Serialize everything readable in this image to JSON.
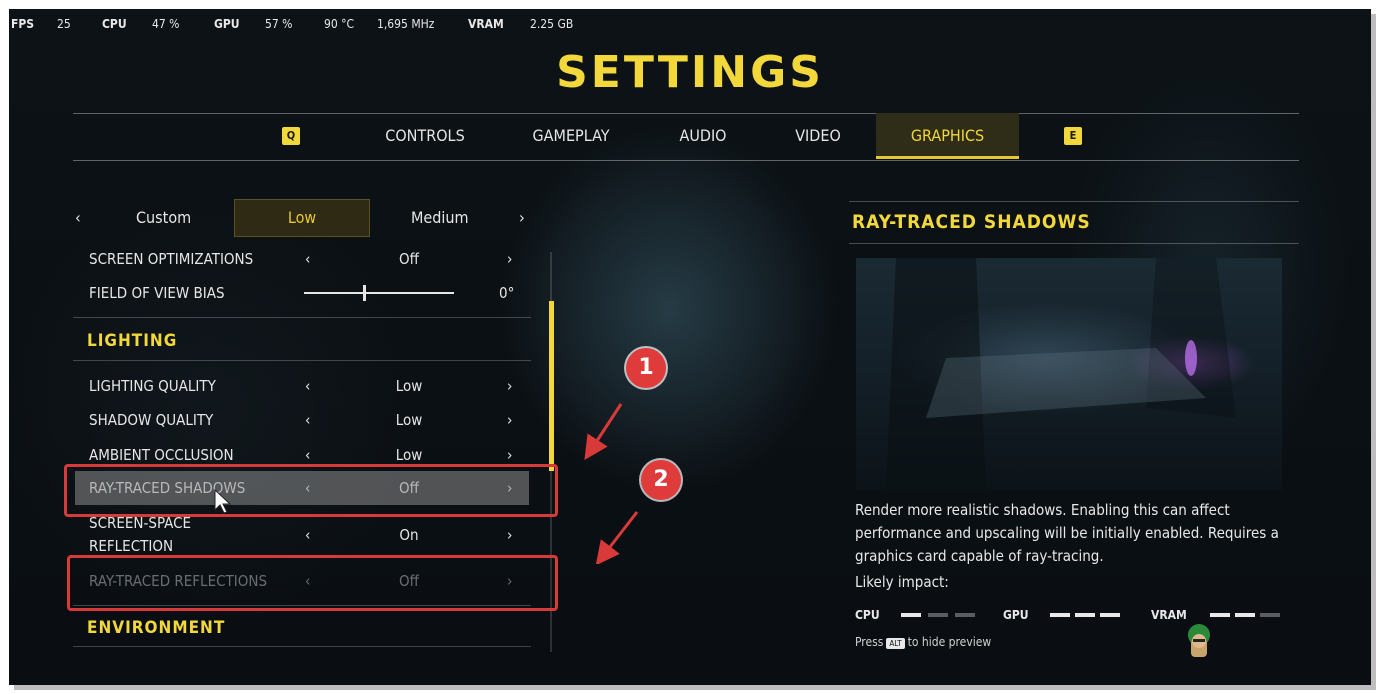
{
  "hud": {
    "fps_label": "FPS",
    "fps_value": "25",
    "cpu_label": "CPU",
    "cpu_value": "47 %",
    "gpu_label": "GPU",
    "gpu_value": "57 %",
    "temp": "90 °C",
    "clock": "1,695 MHz",
    "vram_label": "VRAM",
    "vram_value": "2.25 GB"
  },
  "title": "SETTINGS",
  "tabs": {
    "key_left": "Q",
    "key_right": "E",
    "items": [
      "CONTROLS",
      "GAMEPLAY",
      "AUDIO",
      "VIDEO",
      "GRAPHICS"
    ],
    "active": "GRAPHICS"
  },
  "presets": {
    "left_arrow": "‹",
    "right_arrow": "›",
    "items": [
      "Custom",
      "Low",
      "Medium"
    ],
    "active": "Low"
  },
  "settings": [
    {
      "label": "SCREEN OPTIMIZATIONS",
      "value": "Off"
    },
    {
      "label": "FIELD OF VIEW BIAS",
      "value": "0°",
      "slider": 0.4
    }
  ],
  "sections": {
    "lighting": "LIGHTING",
    "environment": "ENVIRONMENT"
  },
  "lighting": [
    {
      "label": "LIGHTING QUALITY",
      "value": "Low"
    },
    {
      "label": "SHADOW QUALITY",
      "value": "Low"
    },
    {
      "label": "AMBIENT OCCLUSION",
      "value": "Low"
    },
    {
      "label": "RAY-TRACED SHADOWS",
      "value": "Off"
    },
    {
      "label_line1": "SCREEN-SPACE",
      "label_line2": "REFLECTION",
      "value": "On"
    },
    {
      "label": "RAY-TRACED REFLECTIONS",
      "value": "Off"
    }
  ],
  "arrows": {
    "left": "‹",
    "right": "›"
  },
  "annotations": {
    "badge1": "1",
    "badge2": "2",
    "color": "#e03b3b"
  },
  "panel": {
    "title": "RAY-TRACED SHADOWS",
    "description": "Render more realistic shadows. Enabling this can affect performance and upscaling will be initially enabled. Requires a graphics card capable of ray-tracing.",
    "impact_label": "Likely impact:",
    "cpu_label": "CPU",
    "cpu_level": 1,
    "gpu_label": "GPU",
    "gpu_level": 3,
    "vram_label": "VRAM",
    "vram_level": 2,
    "levels_max": 3,
    "hint_prefix": "Press",
    "hint_key": "ALT",
    "hint_suffix": "to hide preview"
  },
  "colors": {
    "accent": "#f2d83a",
    "annotation": "#d83a3a"
  }
}
